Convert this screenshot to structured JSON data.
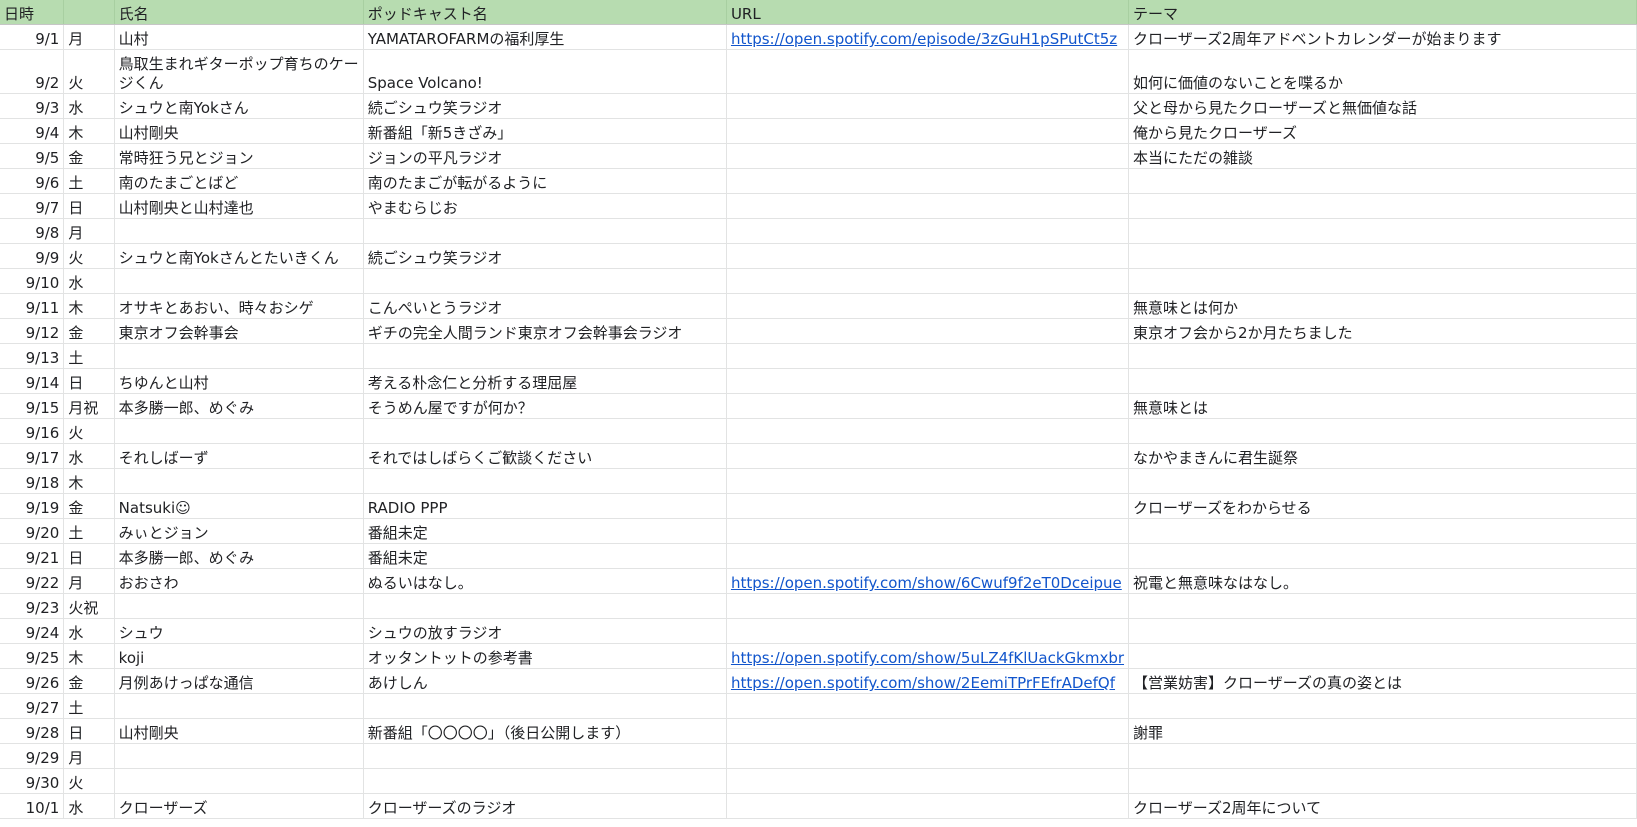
{
  "sheet": {
    "headers": [
      "日時",
      "",
      "氏名",
      "ポッドキャスト名",
      "URL",
      "テーマ"
    ],
    "rows": [
      {
        "date": "9/1",
        "day": "月",
        "name": "山村",
        "podcast": "YAMATAROFARMの福利厚生",
        "url": "https://open.spotify.com/episode/3zGuH1pSPutCt5z",
        "theme": "クローザーズ2周年アドベントカレンダーが始まります"
      },
      {
        "date": "9/2",
        "day": "火",
        "name": "鳥取生まれギターポップ育ちのケージくん",
        "podcast": "Space Volcano!",
        "url": "",
        "theme": "如何に価値のないことを喋るか"
      },
      {
        "date": "9/3",
        "day": "水",
        "name": "シュウと南Yokさん",
        "podcast": "続ごシュウ笑ラジオ",
        "url": "",
        "theme": "父と母から見たクローザーズと無価値な話"
      },
      {
        "date": "9/4",
        "day": "木",
        "name": "山村剛央",
        "podcast": "新番組「新5きざみ」",
        "url": "",
        "theme": "俺から見たクローザーズ"
      },
      {
        "date": "9/5",
        "day": "金",
        "name": "常時狂う兄とジョン",
        "podcast": "ジョンの平凡ラジオ",
        "url": "",
        "theme": "本当にただの雑談"
      },
      {
        "date": "9/6",
        "day": "土",
        "name": "南のたまごとばど",
        "podcast": "南のたまごが転がるように",
        "url": "",
        "theme": ""
      },
      {
        "date": "9/7",
        "day": "日",
        "name": "山村剛央と山村達也",
        "podcast": "やまむらじお",
        "url": "",
        "theme": ""
      },
      {
        "date": "9/8",
        "day": "月",
        "name": "",
        "podcast": "",
        "url": "",
        "theme": ""
      },
      {
        "date": "9/9",
        "day": "火",
        "name": "シュウと南Yokさんとたいきくん",
        "podcast": "続ごシュウ笑ラジオ",
        "url": "",
        "theme": ""
      },
      {
        "date": "9/10",
        "day": "水",
        "name": "",
        "podcast": "",
        "url": "",
        "theme": ""
      },
      {
        "date": "9/11",
        "day": "木",
        "name": "オサキとあおい、時々おシゲ",
        "podcast": "こんぺいとうラジオ",
        "url": "",
        "theme": "無意味とは何か"
      },
      {
        "date": "9/12",
        "day": "金",
        "name": "東京オフ会幹事会",
        "podcast": "ギチの完全人間ランド東京オフ会幹事会ラジオ",
        "url": "",
        "theme": "東京オフ会から2か月たちました"
      },
      {
        "date": "9/13",
        "day": "土",
        "name": "",
        "podcast": "",
        "url": "",
        "theme": ""
      },
      {
        "date": "9/14",
        "day": "日",
        "name": "ちゆんと山村",
        "podcast": "考える朴念仁と分析する理屈屋",
        "url": "",
        "theme": ""
      },
      {
        "date": "9/15",
        "day": "月祝",
        "name": "本多勝一郎、めぐみ",
        "podcast": "そうめん屋ですが何か？",
        "url": "",
        "theme": "無意味とは"
      },
      {
        "date": "9/16",
        "day": "火",
        "name": "",
        "podcast": "",
        "url": "",
        "theme": ""
      },
      {
        "date": "9/17",
        "day": "水",
        "name": "それしばーず",
        "podcast": "それではしばらくご歓談ください",
        "url": "",
        "theme": "なかやまきんに君生誕祭"
      },
      {
        "date": "9/18",
        "day": "木",
        "name": "",
        "podcast": "",
        "url": "",
        "theme": ""
      },
      {
        "date": "9/19",
        "day": "金",
        "name": "Natsuki☺",
        "podcast": "RADIO PPP",
        "url": "",
        "theme": "クローザーズをわからせる"
      },
      {
        "date": "9/20",
        "day": "土",
        "name": "みぃとジョン",
        "podcast": "番組未定",
        "url": "",
        "theme": ""
      },
      {
        "date": "9/21",
        "day": "日",
        "name": "本多勝一郎、めぐみ",
        "podcast": "番組未定",
        "url": "",
        "theme": ""
      },
      {
        "date": "9/22",
        "day": "月",
        "name": "おおさわ",
        "podcast": "ぬるいはなし。",
        "url": "https://open.spotify.com/show/6Cwuf9f2eT0Dceipue",
        "theme": "祝電と無意味なはなし。"
      },
      {
        "date": "9/23",
        "day": "火祝",
        "name": "",
        "podcast": "",
        "url": "",
        "theme": ""
      },
      {
        "date": "9/24",
        "day": "水",
        "name": "シュウ",
        "podcast": "シュウの放すラジオ",
        "url": "",
        "theme": ""
      },
      {
        "date": "9/25",
        "day": "木",
        "name": "koji",
        "podcast": "オッタントットの参考書",
        "url": "https://open.spotify.com/show/5uLZ4fKlUackGkmxbr",
        "theme": ""
      },
      {
        "date": "9/26",
        "day": "金",
        "name": "月例あけっぱな通信",
        "podcast": "あけしん",
        "url": "https://open.spotify.com/show/2EemiTPrFEfrADefQf",
        "theme": "【営業妨害】クローザーズの真の姿とは"
      },
      {
        "date": "9/27",
        "day": "土",
        "name": "",
        "podcast": "",
        "url": "",
        "theme": ""
      },
      {
        "date": "9/28",
        "day": "日",
        "name": "山村剛央",
        "podcast": "新番組「〇〇〇〇」（後日公開します）",
        "url": "",
        "theme": "謝罪"
      },
      {
        "date": "9/29",
        "day": "月",
        "name": "",
        "podcast": "",
        "url": "",
        "theme": ""
      },
      {
        "date": "9/30",
        "day": "火",
        "name": "",
        "podcast": "",
        "url": "",
        "theme": ""
      },
      {
        "date": "10/1",
        "day": "水",
        "name": "クローザーズ",
        "podcast": "クローザーズのラジオ",
        "url": "",
        "theme": "クローザーズ2周年について"
      }
    ]
  }
}
